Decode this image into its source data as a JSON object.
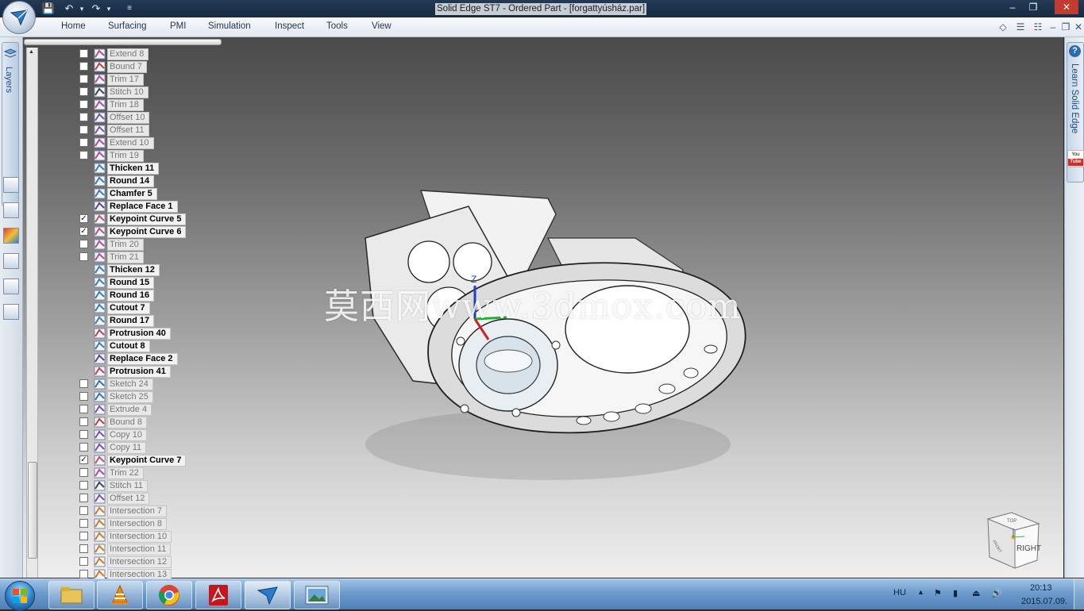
{
  "window": {
    "title": "Solid Edge ST7 - Ordered Part - [forgattyúsház.par]",
    "minimize": "‒",
    "restore": "❐",
    "close": "✕"
  },
  "ribbon": {
    "tabs": [
      "Home",
      "Surfacing",
      "PMI",
      "Simulation",
      "Inspect",
      "Tools",
      "View"
    ]
  },
  "left_panel": {
    "layers_label": "Layers"
  },
  "right_panel": {
    "learn_label": "Learn Solid Edge",
    "youtube_top": "You",
    "youtube_bottom": "Tube"
  },
  "feature_tree": [
    {
      "name": "Extend 8",
      "checked": false,
      "active": false,
      "has_checkbox": true,
      "icon": "extend"
    },
    {
      "name": "Bound 7",
      "checked": false,
      "active": false,
      "has_checkbox": true,
      "icon": "bound"
    },
    {
      "name": "Trim 17",
      "checked": false,
      "active": false,
      "has_checkbox": true,
      "icon": "trim"
    },
    {
      "name": "Stitch 10",
      "checked": false,
      "active": false,
      "has_checkbox": true,
      "icon": "stitch"
    },
    {
      "name": "Trim 18",
      "checked": false,
      "active": false,
      "has_checkbox": true,
      "icon": "trim"
    },
    {
      "name": "Offset 10",
      "checked": false,
      "active": false,
      "has_checkbox": true,
      "icon": "offset"
    },
    {
      "name": "Offset 11",
      "checked": false,
      "active": false,
      "has_checkbox": true,
      "icon": "offset"
    },
    {
      "name": "Extend 10",
      "checked": false,
      "active": false,
      "has_checkbox": true,
      "icon": "extend"
    },
    {
      "name": "Trim 19",
      "checked": false,
      "active": false,
      "has_checkbox": true,
      "icon": "trim"
    },
    {
      "name": "Thicken 11",
      "checked": false,
      "active": true,
      "has_checkbox": false,
      "icon": "thicken"
    },
    {
      "name": "Round 14",
      "checked": false,
      "active": true,
      "has_checkbox": false,
      "icon": "round"
    },
    {
      "name": "Chamfer 5",
      "checked": false,
      "active": true,
      "has_checkbox": false,
      "icon": "chamfer"
    },
    {
      "name": "Replace Face 1",
      "checked": false,
      "active": true,
      "has_checkbox": false,
      "icon": "replace"
    },
    {
      "name": "Keypoint Curve 5",
      "checked": true,
      "active": true,
      "has_checkbox": true,
      "icon": "curve"
    },
    {
      "name": "Keypoint Curve 6",
      "checked": true,
      "active": true,
      "has_checkbox": true,
      "icon": "curve"
    },
    {
      "name": "Trim 20",
      "checked": false,
      "active": false,
      "has_checkbox": true,
      "icon": "trim"
    },
    {
      "name": "Trim 21",
      "checked": false,
      "active": false,
      "has_checkbox": true,
      "icon": "trim"
    },
    {
      "name": "Thicken 12",
      "checked": false,
      "active": true,
      "has_checkbox": false,
      "icon": "thicken"
    },
    {
      "name": "Round 15",
      "checked": false,
      "active": true,
      "has_checkbox": false,
      "icon": "round"
    },
    {
      "name": "Round 16",
      "checked": false,
      "active": true,
      "has_checkbox": false,
      "icon": "round"
    },
    {
      "name": "Cutout 7",
      "checked": false,
      "active": true,
      "has_checkbox": false,
      "icon": "cutout"
    },
    {
      "name": "Round 17",
      "checked": false,
      "active": true,
      "has_checkbox": false,
      "icon": "round"
    },
    {
      "name": "Protrusion 40",
      "checked": false,
      "active": true,
      "has_checkbox": false,
      "icon": "protrusion"
    },
    {
      "name": "Cutout 8",
      "checked": false,
      "active": true,
      "has_checkbox": false,
      "icon": "cutout"
    },
    {
      "name": "Replace Face 2",
      "checked": false,
      "active": true,
      "has_checkbox": false,
      "icon": "replace"
    },
    {
      "name": "Protrusion 41",
      "checked": false,
      "active": true,
      "has_checkbox": false,
      "icon": "protrusion"
    },
    {
      "name": "Sketch 24",
      "checked": false,
      "active": false,
      "has_checkbox": true,
      "icon": "sketch"
    },
    {
      "name": "Sketch 25",
      "checked": false,
      "active": false,
      "has_checkbox": true,
      "icon": "sketch"
    },
    {
      "name": "Extrude 4",
      "checked": false,
      "active": false,
      "has_checkbox": true,
      "icon": "extrude"
    },
    {
      "name": "Bound 8",
      "checked": false,
      "active": false,
      "has_checkbox": true,
      "icon": "bound"
    },
    {
      "name": "Copy 10",
      "checked": false,
      "active": false,
      "has_checkbox": true,
      "icon": "copy"
    },
    {
      "name": "Copy 11",
      "checked": false,
      "active": false,
      "has_checkbox": true,
      "icon": "copy"
    },
    {
      "name": "Keypoint Curve 7",
      "checked": true,
      "active": true,
      "has_checkbox": true,
      "icon": "curve"
    },
    {
      "name": "Trim 22",
      "checked": false,
      "active": false,
      "has_checkbox": true,
      "icon": "trim"
    },
    {
      "name": "Stitch 11",
      "checked": false,
      "active": false,
      "has_checkbox": true,
      "icon": "stitch"
    },
    {
      "name": "Offset 12",
      "checked": false,
      "active": false,
      "has_checkbox": true,
      "icon": "offset"
    },
    {
      "name": "Intersection 7",
      "checked": false,
      "active": false,
      "has_checkbox": true,
      "icon": "intersection"
    },
    {
      "name": "Intersection 8",
      "checked": false,
      "active": false,
      "has_checkbox": true,
      "icon": "intersection"
    },
    {
      "name": "Intersection 10",
      "checked": false,
      "active": false,
      "has_checkbox": true,
      "icon": "intersection"
    },
    {
      "name": "Intersection 11",
      "checked": false,
      "active": false,
      "has_checkbox": true,
      "icon": "intersection"
    },
    {
      "name": "Intersection 12",
      "checked": false,
      "active": false,
      "has_checkbox": true,
      "icon": "intersection"
    },
    {
      "name": "Intersection 13",
      "checked": false,
      "active": false,
      "has_checkbox": true,
      "icon": "intersection"
    }
  ],
  "viewport": {
    "watermark": "莫西网www.3dmox.com",
    "triad": {
      "z_label": "Z"
    },
    "view_cube": {
      "face": "RIGHT",
      "top": "TOP",
      "side": "FRONT"
    }
  },
  "taskbar": {
    "apps": [
      "explorer-icon",
      "vlc-icon",
      "chrome-icon",
      "acrobat-icon",
      "solid-edge-icon",
      "image-viewer-icon"
    ],
    "language": "HU",
    "time": "20:13",
    "date": "2015.07.09."
  },
  "colors": {
    "active_label": "#000000",
    "inactive_label": "#777777",
    "accent_blue": "#2a6bb3"
  }
}
